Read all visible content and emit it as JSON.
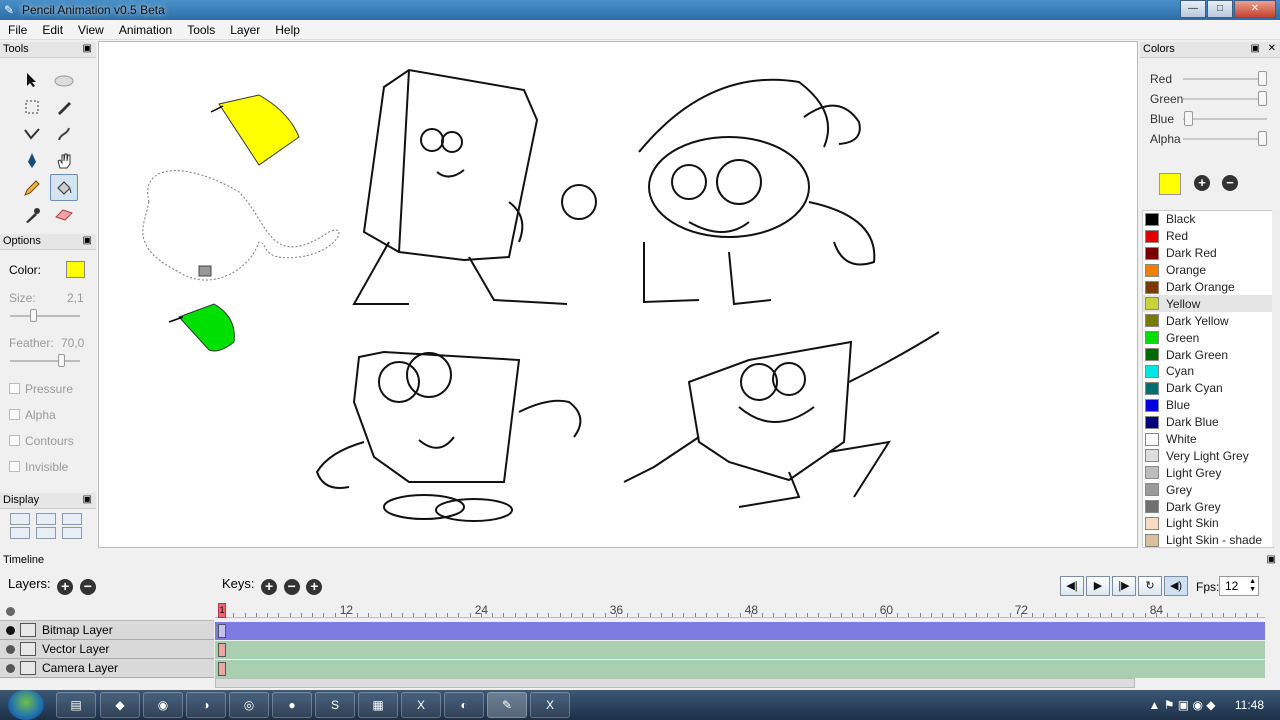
{
  "window": {
    "title": "Pencil Animation v0.5 Beta"
  },
  "menu": [
    "File",
    "Edit",
    "View",
    "Animation",
    "Tools",
    "Layer",
    "Help"
  ],
  "tools_panel": {
    "title": "Tools"
  },
  "options_panel": {
    "title": "Options",
    "color_label": "Color:",
    "color": "#ffff00",
    "size_label": "Size:",
    "size_value": "2,1",
    "feather_label": "Feather:",
    "feather_value": "70,0",
    "checkboxes": [
      "Pressure",
      "Alpha",
      "Contours",
      "Invisible"
    ]
  },
  "display_panel": {
    "title": "Display"
  },
  "colors_panel": {
    "title": "Colors",
    "sliders": [
      "Red",
      "Green",
      "Blue",
      "Alpha"
    ],
    "current": "#ffff00",
    "palette": [
      {
        "name": "Black",
        "color": "#000000"
      },
      {
        "name": "Red",
        "color": "#e00000"
      },
      {
        "name": "Dark Red",
        "color": "#7a0000"
      },
      {
        "name": "Orange",
        "color": "#f08000"
      },
      {
        "name": "Dark Orange",
        "color": "#7a3a00"
      },
      {
        "name": "Yellow",
        "color": "#c8d23c"
      },
      {
        "name": "Dark Yellow",
        "color": "#7a7a00"
      },
      {
        "name": "Green",
        "color": "#00e000"
      },
      {
        "name": "Dark Green",
        "color": "#006a00"
      },
      {
        "name": "Cyan",
        "color": "#00e6e6"
      },
      {
        "name": "Dark Cyan",
        "color": "#007070"
      },
      {
        "name": "Blue",
        "color": "#0000e0"
      },
      {
        "name": "Dark Blue",
        "color": "#00007a"
      },
      {
        "name": "White",
        "color": "#ffffff"
      },
      {
        "name": "Very Light Grey",
        "color": "#dddddd"
      },
      {
        "name": "Light Grey",
        "color": "#bdbdbd"
      },
      {
        "name": "Grey",
        "color": "#9a9a9a"
      },
      {
        "name": "Dark Grey",
        "color": "#707070"
      },
      {
        "name": "Light Skin",
        "color": "#f5dcc0"
      },
      {
        "name": "Light Skin - shade",
        "color": "#d9c09c"
      }
    ]
  },
  "timeline": {
    "title": "Timeline",
    "layers_label": "Layers:",
    "keys_label": "Keys:",
    "fps_label": "Fps:",
    "fps_value": "12",
    "frame_marks": [
      "12",
      "24",
      "36",
      "48",
      "60",
      "72",
      "84"
    ],
    "current_frame": "1",
    "layers": [
      {
        "name": "Bitmap Layer",
        "track_color": "#7c7ce0"
      },
      {
        "name": "Vector Layer",
        "track_color": "#a9cfb0"
      },
      {
        "name": "Camera Layer",
        "track_color": "#a9cfb0"
      }
    ]
  },
  "taskbar": {
    "clock": "11:48"
  }
}
